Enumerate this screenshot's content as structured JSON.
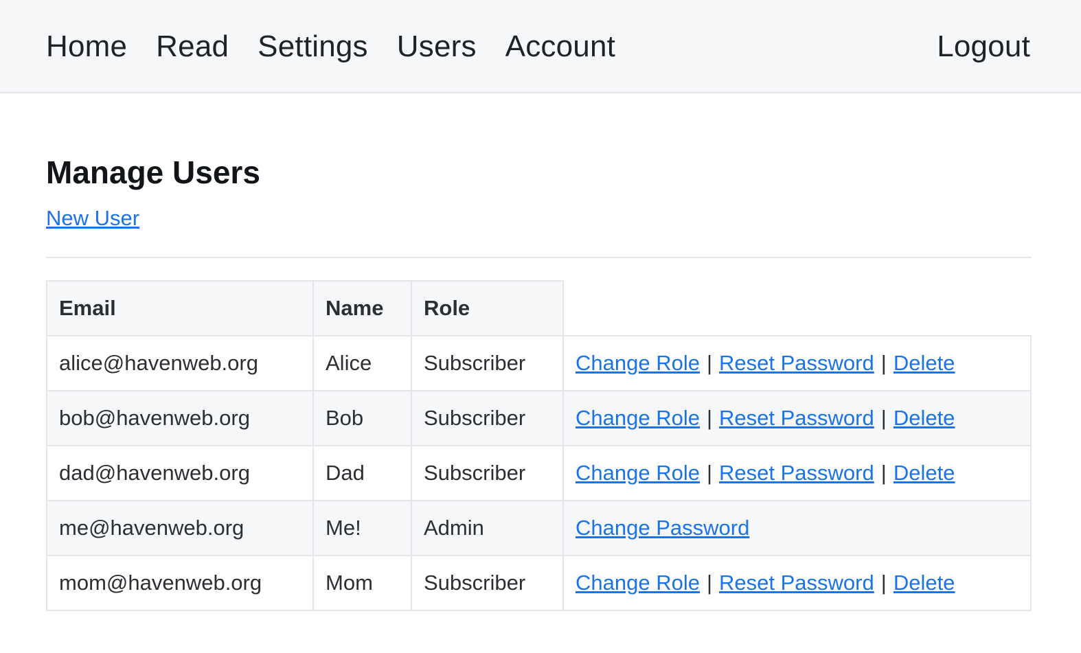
{
  "nav": {
    "items": [
      {
        "label": "Home"
      },
      {
        "label": "Read"
      },
      {
        "label": "Settings"
      },
      {
        "label": "Users"
      },
      {
        "label": "Account"
      }
    ],
    "logout": "Logout"
  },
  "page": {
    "title": "Manage Users",
    "new_user_link": "New User"
  },
  "table": {
    "headers": [
      "Email",
      "Name",
      "Role"
    ],
    "separator": "|",
    "rows": [
      {
        "email": "alice@havenweb.org",
        "name": "Alice",
        "role": "Subscriber",
        "actions": [
          "Change Role",
          "Reset Password",
          "Delete"
        ]
      },
      {
        "email": "bob@havenweb.org",
        "name": "Bob",
        "role": "Subscriber",
        "actions": [
          "Change Role",
          "Reset Password",
          "Delete"
        ]
      },
      {
        "email": "dad@havenweb.org",
        "name": "Dad",
        "role": "Subscriber",
        "actions": [
          "Change Role",
          "Reset Password",
          "Delete"
        ]
      },
      {
        "email": "me@havenweb.org",
        "name": "Me!",
        "role": "Admin",
        "actions": [
          "Change Password"
        ]
      },
      {
        "email": "mom@havenweb.org",
        "name": "Mom",
        "role": "Subscriber",
        "actions": [
          "Change Role",
          "Reset Password",
          "Delete"
        ]
      }
    ]
  }
}
